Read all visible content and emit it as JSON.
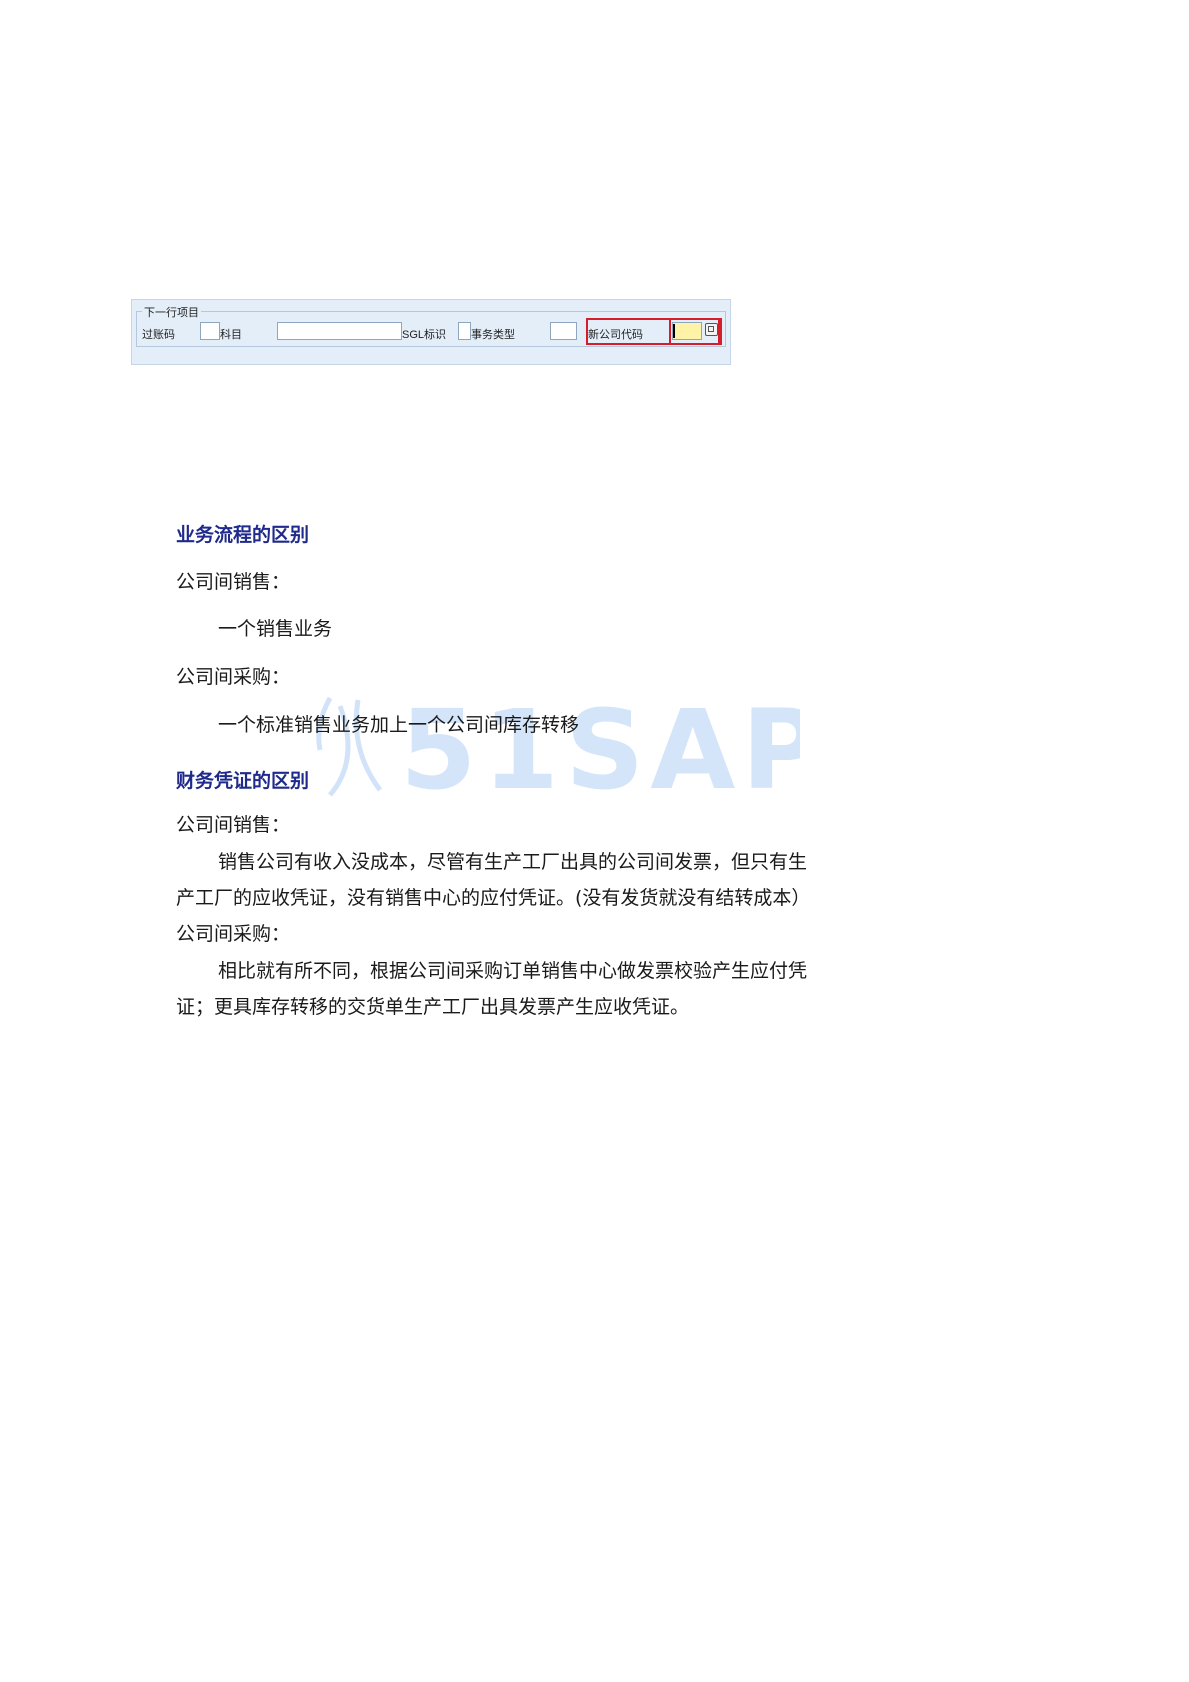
{
  "sap_form": {
    "group_title": "下一行项目",
    "posting_key_label": "过账码",
    "account_label": "科目",
    "sgl_label": "SGL标识",
    "transaction_type_label": "事务类型",
    "new_company_code_label": "新公司代码",
    "posting_key_value": "",
    "account_value": "",
    "sgl_value": "",
    "transaction_type_value": "",
    "new_company_code_value": ""
  },
  "watermark": {
    "text": "51SAP"
  },
  "sections": {
    "business_process": {
      "heading": "业务流程的区别",
      "sales_label": "公司间销售：",
      "sales_text": "一个销售业务",
      "purchase_label": "公司间采购：",
      "purchase_text": "一个标准销售业务加上一个公司间库存转移"
    },
    "financial_voucher": {
      "heading": "财务凭证的区别",
      "sales_label": "公司间销售：",
      "sales_text_line1": "销售公司有收入没成本，尽管有生产工厂出具的公司间发票，但只有生",
      "sales_text_line2": "产工厂的应收凭证，没有销售中心的应付凭证。(没有发货就没有结转成本）",
      "purchase_label": "公司间采购：",
      "purchase_text_line1": "相比就有所不同，根据公司间采购订单销售中心做发票校验产生应付凭",
      "purchase_text_line2": "证；更具库存转移的交货单生产工厂出具发票产生应收凭证。"
    }
  },
  "colors": {
    "heading": "#1f2a8c",
    "highlight": "#d61d2a",
    "field_required": "#fff3a8"
  }
}
